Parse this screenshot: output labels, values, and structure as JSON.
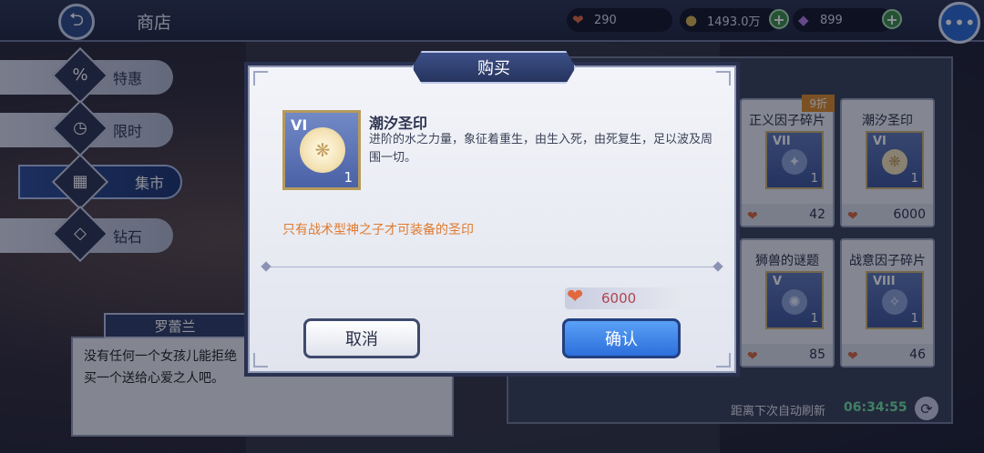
{
  "topbar": {
    "title": "商店",
    "resources": [
      {
        "icon": "heart-icon",
        "value": "290"
      },
      {
        "icon": "coin-icon",
        "value": "1493.0万"
      },
      {
        "icon": "diamond-icon",
        "value": "899"
      }
    ]
  },
  "nav": [
    {
      "label": "特惠",
      "icon": "percent-tag-icon",
      "active": false
    },
    {
      "label": "限时",
      "icon": "clock-icon",
      "active": false
    },
    {
      "label": "集市",
      "icon": "market-stall-icon",
      "active": true
    },
    {
      "label": "钻石",
      "icon": "diamond-box-icon",
      "active": false
    }
  ],
  "speech": {
    "speaker": "罗蕾兰",
    "text": "没有任何一个女孩儿能拒绝买一个送给心爱之人吧。"
  },
  "shop_cards": [
    {
      "name": "正义因子碎片",
      "grade": "VII",
      "count": "1",
      "price": "42",
      "discount": "9折"
    },
    {
      "name": "潮汐圣印",
      "grade": "VI",
      "count": "1",
      "price": "6000",
      "discount": ""
    },
    {
      "name": "狮兽的谜题",
      "grade": "V",
      "count": "1",
      "price": "85",
      "discount": ""
    },
    {
      "name": "战意因子碎片",
      "grade": "VIII",
      "count": "1",
      "price": "46",
      "discount": ""
    }
  ],
  "refresh": {
    "label": "距离下次自动刷新",
    "time": "06:34:55"
  },
  "dialog": {
    "title": "购买",
    "item": {
      "grade": "VI",
      "count": "1",
      "name": "潮汐圣印",
      "description": "进阶的水之力量，象征着重生，由生入死，由死复生，足以波及周围一切。",
      "note": "只有战术型神之子才可装备的圣印"
    },
    "price": "6000",
    "cancel_label": "取消",
    "confirm_label": "确认"
  },
  "colors": {
    "accent_blue": "#2d6fdc",
    "note_orange": "#df7a2e",
    "timer_green": "#6ee0a0"
  }
}
